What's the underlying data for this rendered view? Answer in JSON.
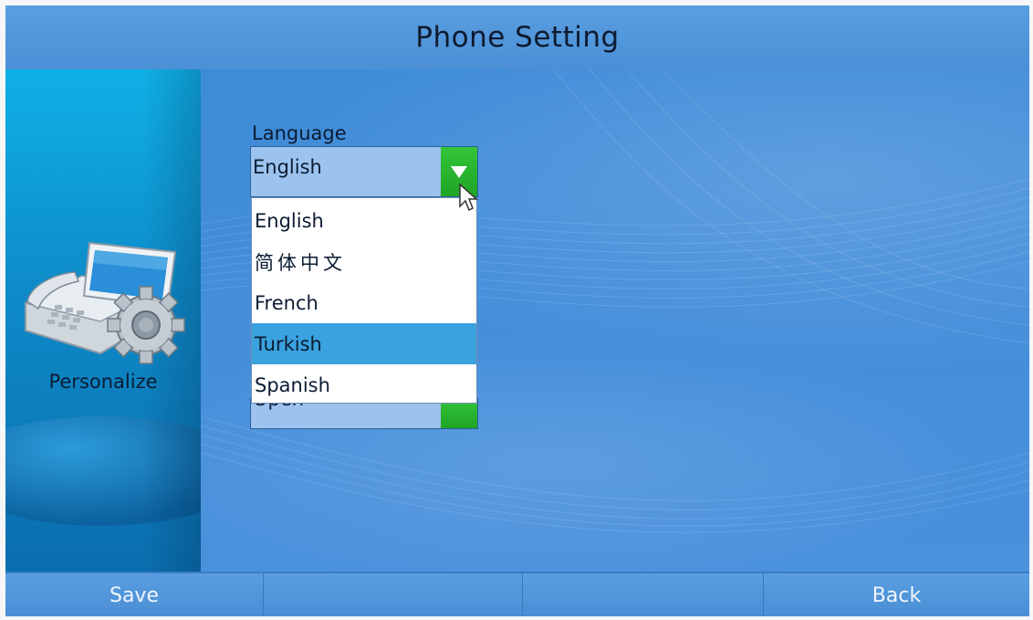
{
  "title": "Phone Setting",
  "sidebar": {
    "label": "Personalize",
    "icon": "phone-settings-icon"
  },
  "language": {
    "label": "Language",
    "selected": "English",
    "options": [
      {
        "label": "English",
        "highlighted": false
      },
      {
        "label": "简体中文",
        "highlighted": false
      },
      {
        "label": "French",
        "highlighted": false
      },
      {
        "label": "Turkish",
        "highlighted": true
      },
      {
        "label": "Spanish",
        "highlighted": false
      }
    ]
  },
  "second_field": {
    "selected": "Open"
  },
  "softkeys": {
    "key1": "Save",
    "key2": "",
    "key3": "",
    "key4": "Back"
  },
  "colors": {
    "background": "#3f86d4",
    "sidebar": "#0e8ac8",
    "arrow_button": "#2ab530",
    "highlight": "#3aa2df",
    "text": "#0b1c33",
    "softkey_text": "#f2f6fb"
  }
}
